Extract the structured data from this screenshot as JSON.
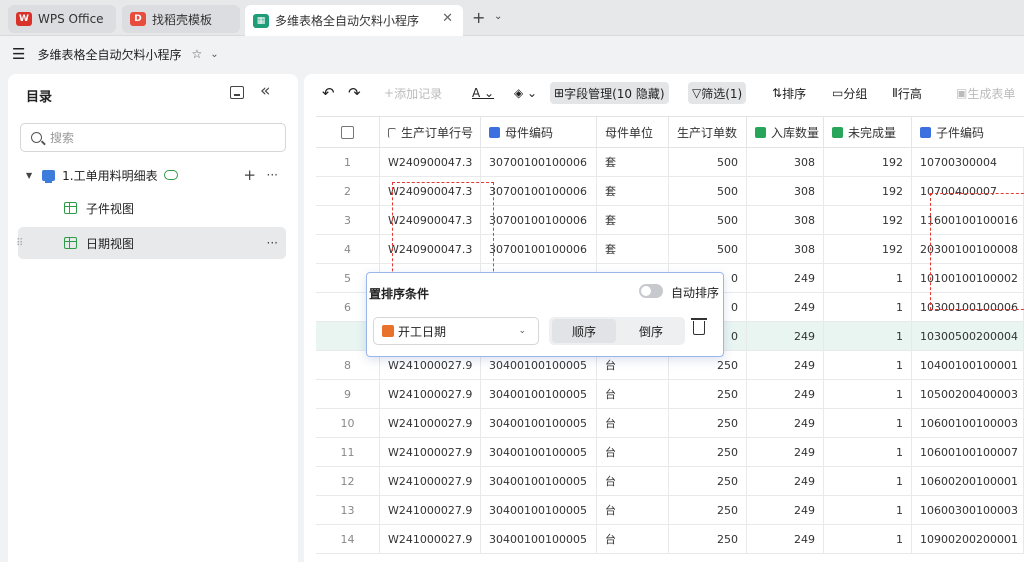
{
  "tabs": [
    {
      "label": "WPS Office",
      "icon": "wps-icon",
      "color": "#d9322b"
    },
    {
      "label": "找稻壳模板",
      "icon": "docer-icon",
      "color": "#e84c3d"
    },
    {
      "label": "多维表格全自动欠料小程序",
      "icon": "table-icon",
      "color": "#1f9d78",
      "active": true
    }
  ],
  "breadcrumb": {
    "title": "多维表格全自动欠料小程序"
  },
  "sidebar": {
    "title": "目录",
    "search_placeholder": "搜索",
    "tree": [
      {
        "label": "1.工单用料明细表"
      },
      {
        "label": "子件视图"
      },
      {
        "label": "日期视图",
        "selected": true
      }
    ]
  },
  "toolbar": {
    "add_record": "添加记录",
    "field_manage": "字段管理(10 隐藏)",
    "filter": "筛选(1)",
    "sort": "排序",
    "group": "分组",
    "row_height": "行高",
    "generate": "生成表单"
  },
  "columns": [
    "生产订单行号",
    "母件编码",
    "母件单位",
    "生产订单数",
    "入库数量",
    "未完成量",
    "子件编码"
  ],
  "rows": [
    {
      "idx": "1",
      "order": "W240900047.3",
      "parent": "30700100100006",
      "unit": "套",
      "qty": "500",
      "in": "308",
      "left": "192",
      "child": "10700300004"
    },
    {
      "idx": "2",
      "order": "W240900047.3",
      "parent": "30700100100006",
      "unit": "套",
      "qty": "500",
      "in": "308",
      "left": "192",
      "child": "10700400007"
    },
    {
      "idx": "3",
      "order": "W240900047.3",
      "parent": "30700100100006",
      "unit": "套",
      "qty": "500",
      "in": "308",
      "left": "192",
      "child": "11600100100016"
    },
    {
      "idx": "4",
      "order": "W240900047.3",
      "parent": "30700100100006",
      "unit": "套",
      "qty": "500",
      "in": "308",
      "left": "192",
      "child": "20300100100008"
    },
    {
      "idx": "5",
      "order": "",
      "parent": "",
      "unit": "",
      "qty": "0",
      "in": "249",
      "left": "1",
      "child": "10100100100002"
    },
    {
      "idx": "6",
      "order": "",
      "parent": "",
      "unit": "",
      "qty": "0",
      "in": "249",
      "left": "1",
      "child": "10300100100006"
    },
    {
      "idx": "",
      "order": "",
      "parent": "",
      "unit": "",
      "qty": "0",
      "in": "249",
      "left": "1",
      "child": "10300500200004"
    },
    {
      "idx": "8",
      "order": "W241000027.9",
      "parent": "30400100100005",
      "unit": "台",
      "qty": "250",
      "in": "249",
      "left": "1",
      "child": "10400100100001"
    },
    {
      "idx": "9",
      "order": "W241000027.9",
      "parent": "30400100100005",
      "unit": "台",
      "qty": "250",
      "in": "249",
      "left": "1",
      "child": "10500200400003"
    },
    {
      "idx": "10",
      "order": "W241000027.9",
      "parent": "30400100100005",
      "unit": "台",
      "qty": "250",
      "in": "249",
      "left": "1",
      "child": "10600100100003"
    },
    {
      "idx": "11",
      "order": "W241000027.9",
      "parent": "30400100100005",
      "unit": "台",
      "qty": "250",
      "in": "249",
      "left": "1",
      "child": "10600100100007"
    },
    {
      "idx": "12",
      "order": "W241000027.9",
      "parent": "30400100100005",
      "unit": "台",
      "qty": "250",
      "in": "249",
      "left": "1",
      "child": "10600200100001"
    },
    {
      "idx": "13",
      "order": "W241000027.9",
      "parent": "30400100100005",
      "unit": "台",
      "qty": "250",
      "in": "249",
      "left": "1",
      "child": "10600300100003"
    },
    {
      "idx": "14",
      "order": "W241000027.9",
      "parent": "30400100100005",
      "unit": "台",
      "qty": "250",
      "in": "249",
      "left": "1",
      "child": "10900200200001"
    }
  ],
  "sort_popup": {
    "title": "置排序条件",
    "auto_sort": "自动排序",
    "field": "开工日期",
    "asc": "顺序",
    "desc": "倒序"
  }
}
